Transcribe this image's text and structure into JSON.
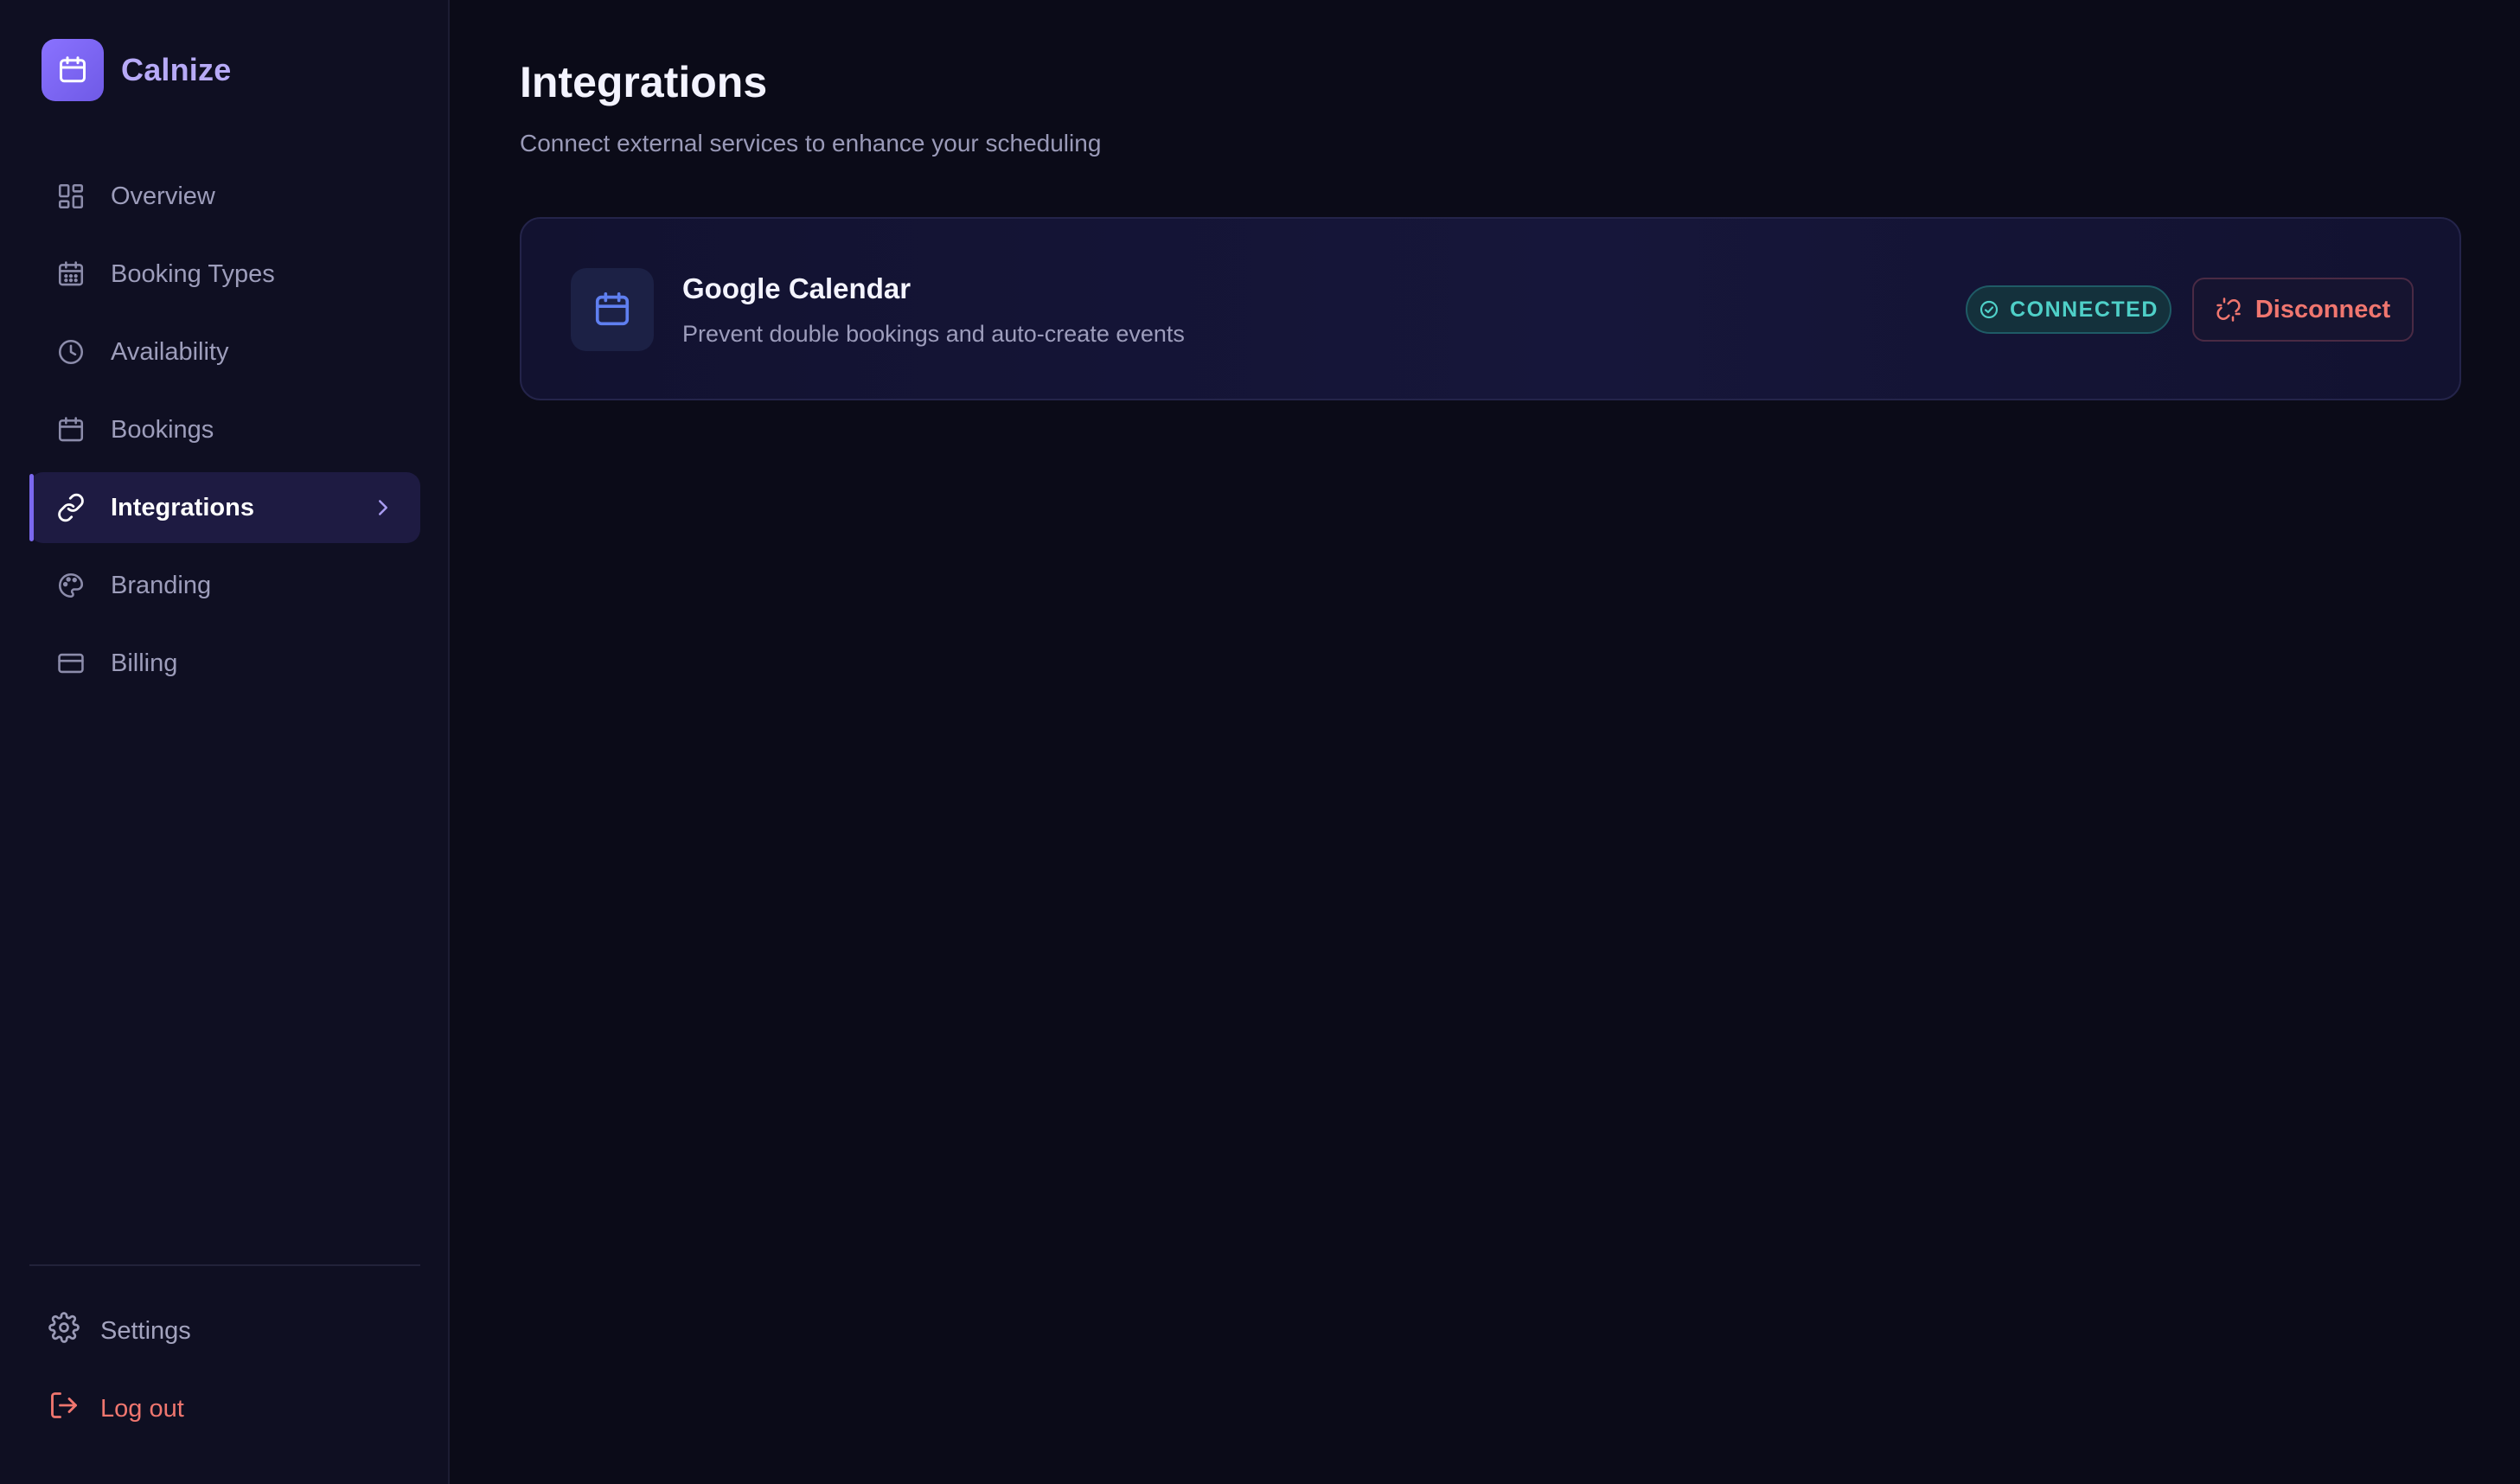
{
  "app": {
    "name": "Calnize"
  },
  "sidebar": {
    "items": [
      {
        "label": "Overview",
        "icon": "grid-icon"
      },
      {
        "label": "Booking Types",
        "icon": "calendar-grid-icon"
      },
      {
        "label": "Availability",
        "icon": "clock-icon"
      },
      {
        "label": "Bookings",
        "icon": "calendar-icon"
      },
      {
        "label": "Integrations",
        "icon": "link-icon",
        "active": true
      },
      {
        "label": "Branding",
        "icon": "palette-icon"
      },
      {
        "label": "Billing",
        "icon": "credit-card-icon"
      }
    ],
    "settings_label": "Settings",
    "logout_label": "Log out"
  },
  "page": {
    "title": "Integrations",
    "subtitle": "Connect external services to enhance your scheduling"
  },
  "integrations": [
    {
      "name": "Google Calendar",
      "description": "Prevent double bookings and auto-create events",
      "status": "CONNECTED",
      "action_label": "Disconnect"
    }
  ],
  "colors": {
    "accent": "#7b68ee",
    "background": "#0b0b18",
    "sidebar": "#0f0f22",
    "connected": "#4fd0c8",
    "danger": "#f0766f"
  }
}
